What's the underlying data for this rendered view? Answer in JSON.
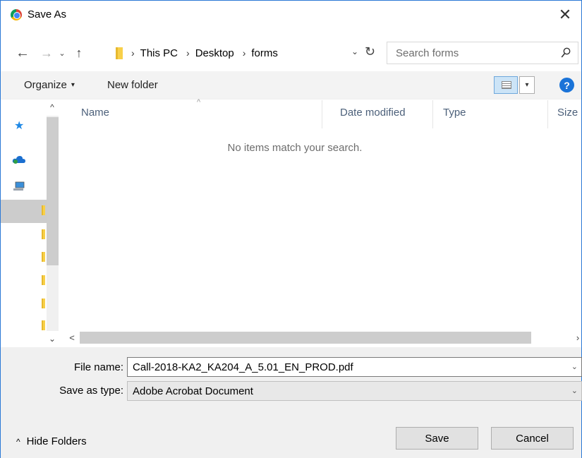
{
  "window": {
    "title": "Save As",
    "app_icon": "chrome-icon",
    "close_glyph": "✕"
  },
  "nav": {
    "back_glyph": "←",
    "forward_glyph": "→",
    "recent_glyph": "⌄",
    "up_glyph": "↑",
    "breadcrumb": [
      "This PC",
      "Desktop",
      "forms"
    ],
    "separator": "›",
    "dropdown_glyph": "⌄",
    "refresh_glyph": "↻"
  },
  "search": {
    "placeholder": "Search forms"
  },
  "toolbar": {
    "organize_label": "Organize",
    "organize_caret": "▾",
    "new_folder_label": "New folder",
    "view_caret": "▾",
    "help_glyph": "?"
  },
  "navpane": {
    "scroll_up_glyph": "^",
    "scroll_down_glyph": "⌄",
    "quick_access_glyph": "★"
  },
  "filelist": {
    "columns": [
      "Name",
      "Date modified",
      "Type",
      "Size"
    ],
    "sort_caret": "^",
    "empty_message": "No items match your search.",
    "scroll_left_glyph": "<",
    "scroll_right_glyph": "›"
  },
  "form": {
    "file_name_label": "File name:",
    "file_name_value": "Call-2018-KA2_KA204_A_5.01_EN_PROD.pdf",
    "save_type_label": "Save as type:",
    "save_type_value": "Adobe Acrobat Document",
    "dropdown_glyph": "⌄"
  },
  "footer": {
    "hide_folders_label": "Hide Folders",
    "hide_caret": "^",
    "save_label": "Save",
    "cancel_label": "Cancel"
  },
  "colors": {
    "accent": "#2b79d6",
    "help": "#1a73d8",
    "folder": "#f8d04a"
  }
}
